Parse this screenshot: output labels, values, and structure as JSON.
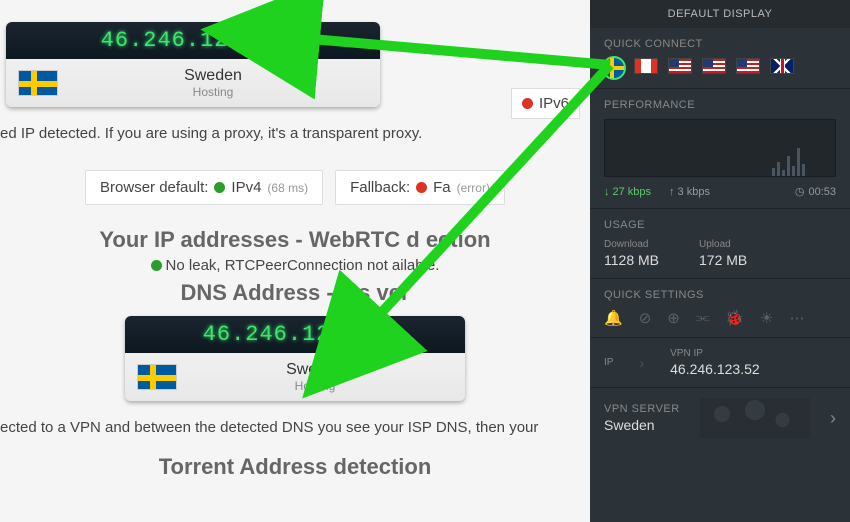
{
  "main": {
    "ip_card1": {
      "ip": "46.246.123.52",
      "country": "Sweden",
      "type": "Hosting"
    },
    "proxy_text": "ed IP detected. If you are using a proxy, it's a transparent proxy.",
    "browser_default_label": "Browser default:",
    "ipv4_label": "IPv4",
    "ipv4_latency": "(68 ms)",
    "fallback_label": "Fallback:",
    "fallback_fail": "Fa",
    "fallback_err": "(error)",
    "webrtc_title": "Your IP addresses - WebRTC d",
    "webrtc_title2": "ection",
    "noleak_text": "No leak, RTCPeerConnection not",
    "noleak_text2": "ailable.",
    "dns_title": "DNS Address - 1 s",
    "dns_title2": "ver",
    "dns_card": {
      "ip": "46.246.123.52",
      "country": "Sweden",
      "type": "Hosting"
    },
    "vpn_text": "ected to a VPN and between the detected DNS you see your ISP DNS, then your",
    "torrent_title": "Torrent Address detection",
    "ipv6_badge": "IPv6"
  },
  "sidebar": {
    "header": "DEFAULT DISPLAY",
    "quick_connect_label": "QUICK CONNECT",
    "performance_label": "PERFORMANCE",
    "down_speed": "27 kbps",
    "up_speed": "3 kbps",
    "timer": "00:53",
    "usage_label": "USAGE",
    "download_label": "Download",
    "download_val": "1128 MB",
    "upload_label": "Upload",
    "upload_val": "172 MB",
    "quick_settings_label": "QUICK SETTINGS",
    "ip_label": "IP",
    "vpnip_label": "VPN IP",
    "vpnip_val": "46.246.123.52",
    "vpnserver_label": "VPN SERVER",
    "vpnserver_val": "Sweden"
  }
}
